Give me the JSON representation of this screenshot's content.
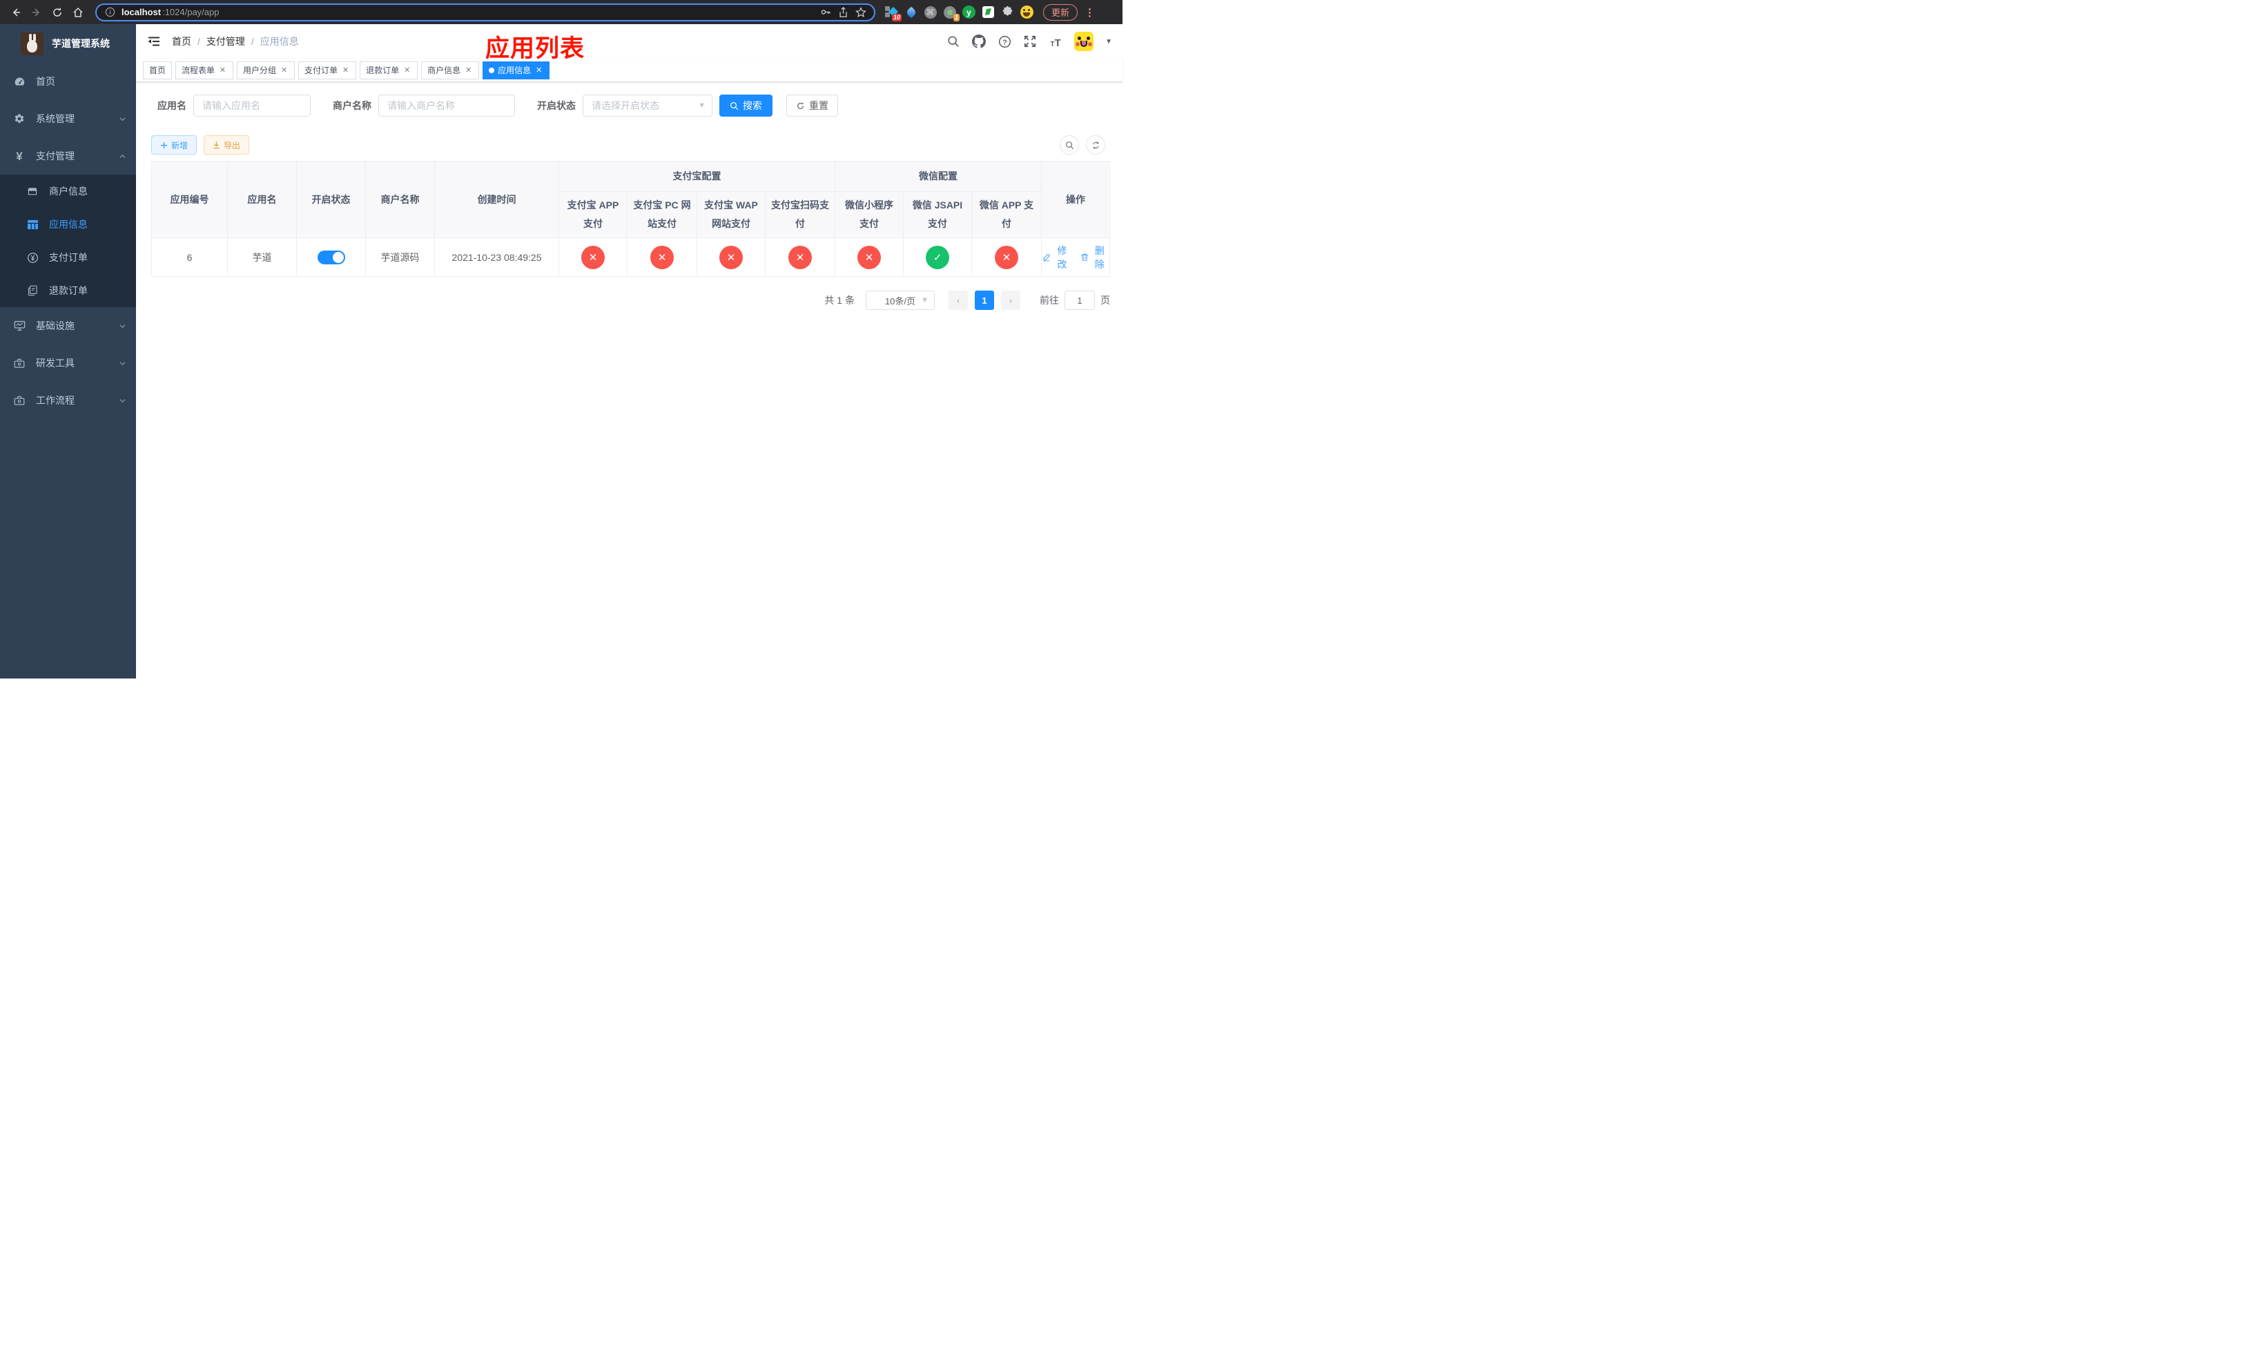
{
  "browser": {
    "url_host": "localhost",
    "url_rest": ":1024/pay/app",
    "update_label": "更新",
    "extensions": {
      "badge_a": "10",
      "badge_b": "1",
      "y_label": "y"
    }
  },
  "sidebar": {
    "title": "芋道管理系统",
    "menu": [
      {
        "label": "首页"
      },
      {
        "label": "系统管理"
      },
      {
        "label": "支付管理"
      },
      {
        "label": "商户信息"
      },
      {
        "label": "应用信息"
      },
      {
        "label": "支付订单"
      },
      {
        "label": "退款订单"
      },
      {
        "label": "基础设施"
      },
      {
        "label": "研发工具"
      },
      {
        "label": "工作流程"
      }
    ]
  },
  "navbar": {
    "breadcrumb": [
      "首页",
      "支付管理",
      "应用信息"
    ]
  },
  "annotation": "应用列表",
  "tabs": [
    {
      "label": "首页"
    },
    {
      "label": "流程表单"
    },
    {
      "label": "用户分组"
    },
    {
      "label": "支付订单"
    },
    {
      "label": "退款订单"
    },
    {
      "label": "商户信息"
    },
    {
      "label": "应用信息"
    }
  ],
  "filters": {
    "app_name_label": "应用名",
    "app_name_placeholder": "请输入应用名",
    "merchant_label": "商户名称",
    "merchant_placeholder": "请输入商户名称",
    "status_label": "开启状态",
    "status_placeholder": "请选择开启状态",
    "search_label": "搜索",
    "reset_label": "重置"
  },
  "toolbar": {
    "add_label": "新增",
    "export_label": "导出"
  },
  "table": {
    "headers": [
      "应用编号",
      "应用名",
      "开启状态",
      "商户名称",
      "创建时间"
    ],
    "group_alipay": "支付宝配置",
    "group_wechat": "微信配置",
    "sub_headers": [
      "支付宝 APP 支付",
      "支付宝 PC 网站支付",
      "支付宝 WAP 网站支付",
      "支付宝扫码支付",
      "微信小程序支付",
      "微信 JSAPI 支付",
      "微信 APP 支付"
    ],
    "ops_header": "操作",
    "row": {
      "id": "6",
      "name": "芋道",
      "enabled": true,
      "merchant": "芋道源码",
      "created": "2021-10-23 08:49:25",
      "statuses": [
        "fail",
        "fail",
        "fail",
        "fail",
        "fail",
        "pass",
        "fail"
      ],
      "edit_label": "修改",
      "delete_label": "删除"
    }
  },
  "pagination": {
    "total": "共 1 条",
    "page_size": "10条/页",
    "current_page": "1",
    "goto_label": "前往",
    "goto_value": "1",
    "page_unit": "页"
  },
  "colors": {
    "accent": "#1a8cff",
    "danger": "#f9544b",
    "success": "#17c26b",
    "sidebar": "#304156"
  }
}
